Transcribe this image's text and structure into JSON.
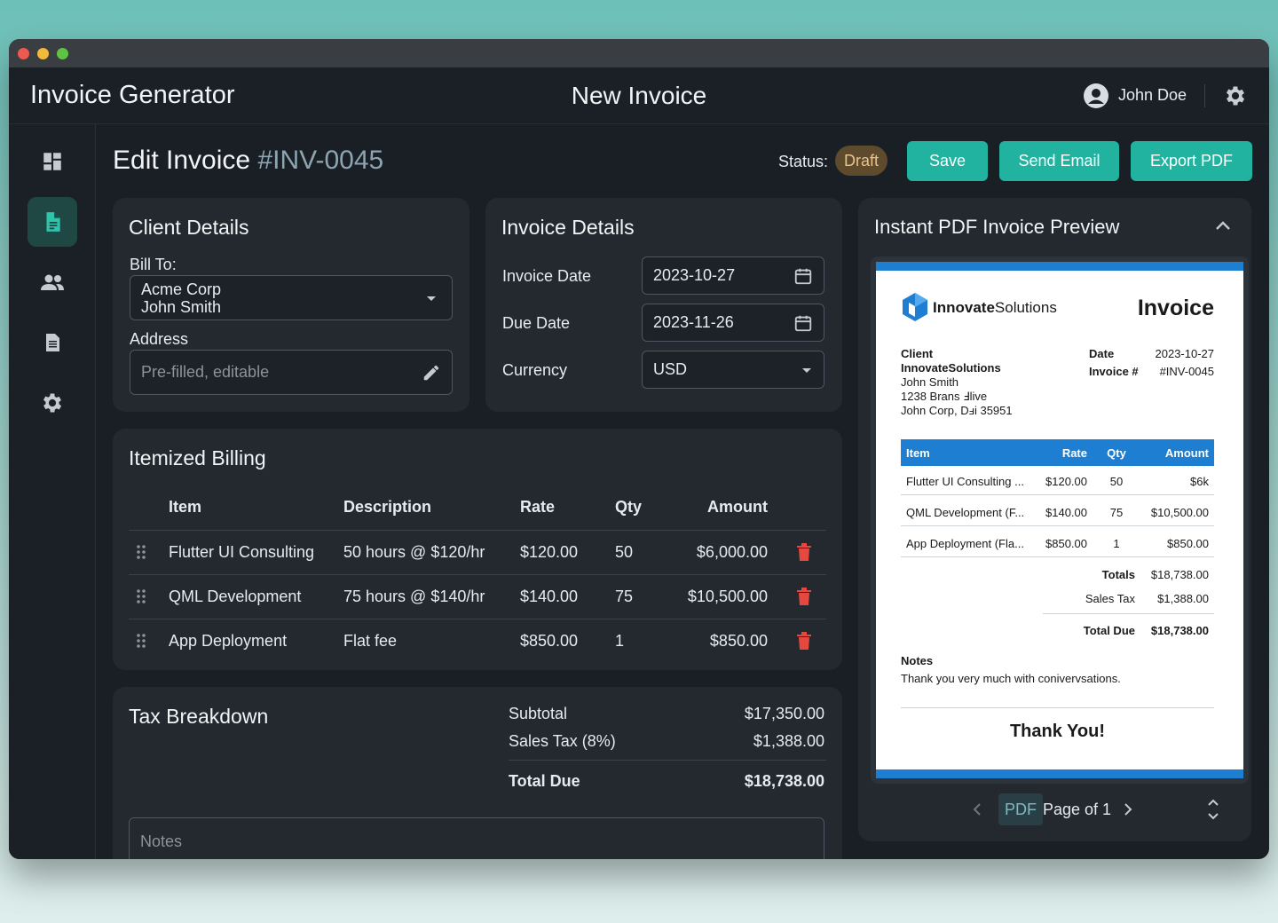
{
  "app": {
    "title": "Invoice Generator",
    "center_title": "New Invoice",
    "user_name": "John Doe"
  },
  "sidebar": {
    "items": [
      "dashboard",
      "invoices",
      "clients",
      "reports",
      "settings"
    ]
  },
  "header": {
    "title": "Edit Invoice",
    "invoice_number": "#INV-0045",
    "status_label": "Status:",
    "status": "Draft",
    "save_label": "Save",
    "send_label": "Send Email",
    "export_label": "Export PDF"
  },
  "client": {
    "title": "Client Details",
    "bill_to_label": "Bill To:",
    "company": "Acme Corp",
    "contact": "John Smith",
    "address_label": "Address",
    "address_placeholder": "Pre-filled, editable"
  },
  "invoice": {
    "title": "Invoice Details",
    "date_label": "Invoice Date",
    "date": "2023-10-27",
    "due_label": "Due Date",
    "due": "2023-11-26",
    "currency_label": "Currency",
    "currency": "USD"
  },
  "billing": {
    "title": "Itemized Billing",
    "columns": [
      "Item",
      "Description",
      "Rate",
      "Qty",
      "Amount"
    ],
    "rows": [
      {
        "item": "Flutter UI Consulting",
        "description": "50 hours @ $120/hr",
        "rate": "$120.00",
        "qty": "50",
        "amount": "$6,000.00"
      },
      {
        "item": "QML Development",
        "description": "75 hours @ $140/hr",
        "rate": "$140.00",
        "qty": "75",
        "amount": "$10,500.00"
      },
      {
        "item": "App Deployment",
        "description": "Flat fee",
        "rate": "$850.00",
        "qty": "1",
        "amount": "$850.00"
      }
    ]
  },
  "tax": {
    "title": "Tax Breakdown",
    "subtotal_label": "Subtotal",
    "subtotal": "$17,350.00",
    "tax_label": "Sales Tax (8%)",
    "tax": "$1,388.00",
    "total_label": "Total Due",
    "total": "$18,738.00",
    "notes_placeholder": "Notes"
  },
  "preview": {
    "title": "Instant PDF Invoice Preview",
    "company_bold": "Innovate",
    "company_rest": "Solutions",
    "doc_title": "Invoice",
    "client_label": "Client",
    "client_lines": [
      "InnovateSolutions",
      "John Smith",
      "1238 Brans Ⅎlive",
      "John Corp, Dⅎi 35951"
    ],
    "date_label": "Date",
    "date": "2023-10-27",
    "invoice_label": "Invoice #",
    "invoice_no": "#INV-0045",
    "columns": [
      "Item",
      "Rate",
      "Qty",
      "Amount"
    ],
    "rows": [
      {
        "item": "Flutter UI Consulting ...",
        "rate": "$120.00",
        "qty": "50",
        "amount": "$6k"
      },
      {
        "item": "QML Development (F...",
        "rate": "$140.00",
        "qty": "75",
        "amount": "$10,500.00"
      },
      {
        "item": "App Deployment (Fla...",
        "rate": "$850.00",
        "qty": "1",
        "amount": "$850.00"
      }
    ],
    "totals_label": "Totals",
    "totals": "$18,738.00",
    "tax_label": "Sales Tax",
    "tax": "$1,388.00",
    "due_label": "Total Due",
    "due": "$18,738.00",
    "notes_label": "Notes",
    "notes": "Thank you very much with conivervsations.",
    "thanks": "Thank You!",
    "pager_chip": "PDF",
    "pager_text": "Page of 1"
  },
  "colors": {
    "accent": "#21b39f",
    "pdf_blue": "#1e7fd2",
    "danger": "#e5483f",
    "draft_badge": "#5e4a2c"
  }
}
